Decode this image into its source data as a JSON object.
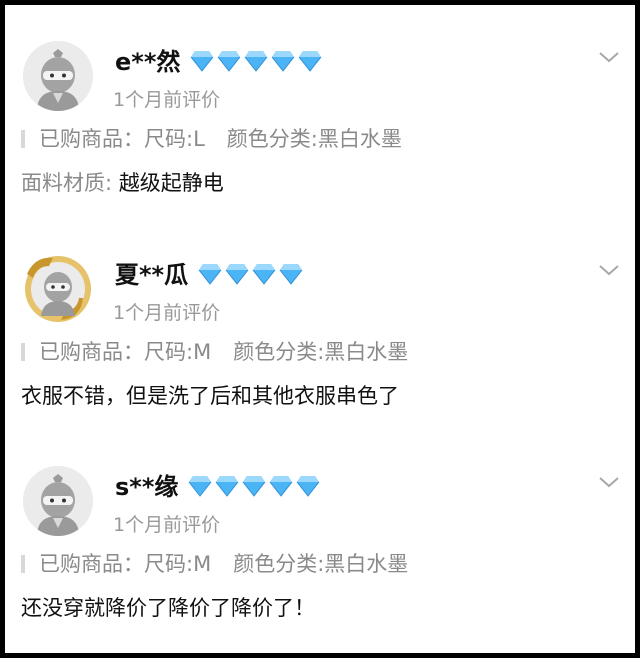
{
  "reviews": [
    {
      "username": "e**然",
      "badge_count": 5,
      "date": "1个月前评价",
      "attr_purchased_label": "已购商品：",
      "attr_size": "尺码:L",
      "attr_color": "颜色分类:黑白水墨",
      "content_label": "面料材质: ",
      "content_text": "越级起静电",
      "avatar_icon": "default-ninja-avatar",
      "expand_icon": "chevron-down-icon"
    },
    {
      "username": "夏**瓜",
      "badge_count": 4,
      "date": "1个月前评价",
      "attr_purchased_label": "已购商品：",
      "attr_size": "尺码:M",
      "attr_color": "颜色分类:黑白水墨",
      "content_label": "",
      "content_text": "衣服不错，但是洗了后和其他衣服串色了",
      "avatar_icon": "gold-frame-ninja-avatar",
      "expand_icon": "chevron-down-icon"
    },
    {
      "username": "s**缘",
      "badge_count": 5,
      "date": "1个月前评价",
      "attr_purchased_label": "已购商品：",
      "attr_size": "尺码:M",
      "attr_color": "颜色分类:黑白水墨",
      "content_label": "",
      "content_text": "还没穿就降价了降价了降价了！",
      "avatar_icon": "default-ninja-avatar",
      "expand_icon": "chevron-down-icon"
    }
  ],
  "colors": {
    "background": "#ffffff",
    "frame": "#000000",
    "username": "#111111",
    "muted_text": "#999999",
    "diamond": "#4bb4f5"
  }
}
